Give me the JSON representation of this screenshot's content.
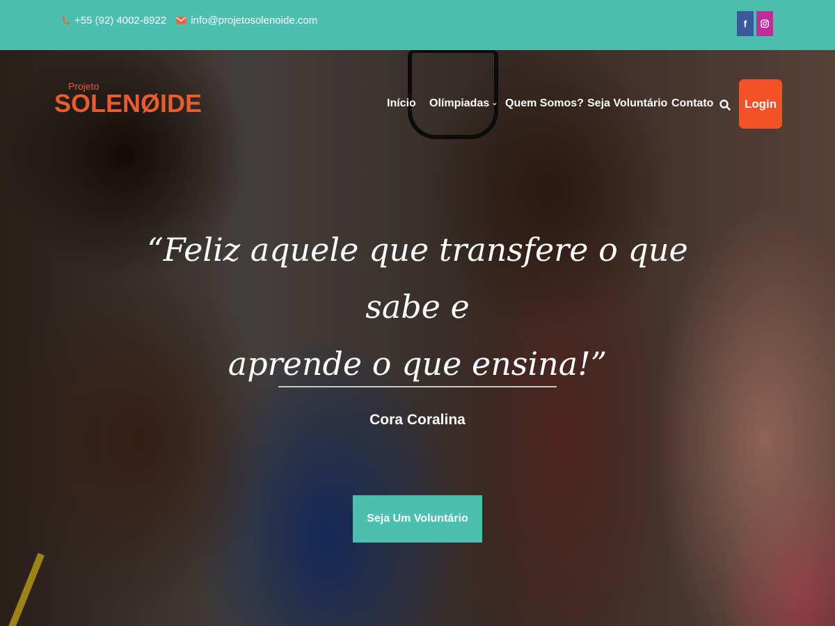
{
  "topbar": {
    "phone": "+55 (92) 4002-8922",
    "email": "info@projetosolenoide.com",
    "social": [
      "facebook-icon",
      "instagram-icon"
    ]
  },
  "logo": {
    "small": "Projeto",
    "big": "SOLENØIDE"
  },
  "nav": {
    "items": [
      "Início",
      "Olímpiadas",
      "Quem Somos?",
      "Seja Voluntário",
      "Contato"
    ],
    "login": "Login"
  },
  "hero": {
    "quote_line1": "“Feliz aquele que transfere o que sabe e",
    "quote_line2": "aprende o que ensina!”",
    "author": "Cora Coralina",
    "cta": "Seja Um Voluntário"
  },
  "colors": {
    "teal": "#4bbfb0",
    "orange": "#f45128",
    "logo": "#e85d2e",
    "facebook": "#3b5998",
    "instagram": "#c02c9a"
  }
}
